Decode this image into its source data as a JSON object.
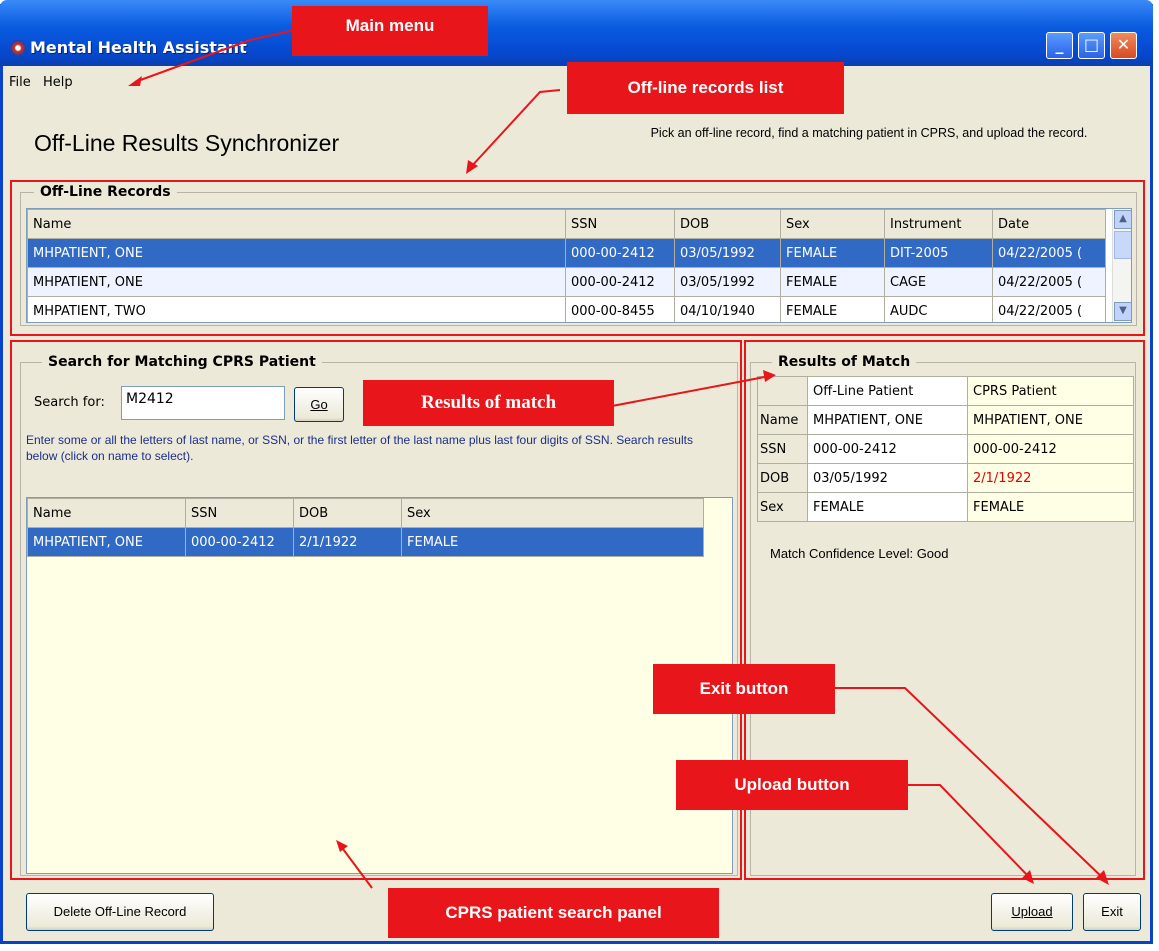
{
  "window": {
    "title": "Mental Health Assistant",
    "minimize": "_",
    "maximize": "□",
    "close": "✕"
  },
  "menu": {
    "file": "File",
    "help": "Help"
  },
  "header": {
    "title": "Off-Line Results Synchronizer",
    "instructions": "Pick an off-line record, find a matching patient in CPRS, and upload the record."
  },
  "offline_records": {
    "group_title": "Off-Line Records",
    "columns": [
      "Name",
      "SSN",
      "DOB",
      "Sex",
      "Instrument",
      "Date"
    ],
    "rows": [
      [
        "MHPATIENT, ONE",
        "000-00-2412",
        "03/05/1992",
        "FEMALE",
        "DIT-2005",
        "04/22/2005 ("
      ],
      [
        "MHPATIENT, ONE",
        "000-00-2412",
        "03/05/1992",
        "FEMALE",
        "CAGE",
        "04/22/2005 ("
      ],
      [
        "MHPATIENT, TWO",
        "000-00-8455",
        "04/10/1940",
        "FEMALE",
        "AUDC",
        "04/22/2005 ("
      ]
    ]
  },
  "search": {
    "group_title": "Search for Matching CPRS Patient",
    "label": "Search for:",
    "value": "M2412",
    "go": "Go",
    "help": "Enter some or all the letters of last name, or SSN, or the first letter of the last name plus last four digits of SSN. Search results below (click on name to select).",
    "columns": [
      "Name",
      "SSN",
      "DOB",
      "Sex"
    ],
    "rows": [
      [
        "MHPATIENT, ONE",
        "000-00-2412",
        "2/1/1922",
        "FEMALE"
      ]
    ]
  },
  "match": {
    "group_title": "Results of Match",
    "col_offline": "Off-Line Patient",
    "col_cprs": "CPRS Patient",
    "rows": [
      {
        "label": "Name",
        "offline": "MHPATIENT, ONE",
        "cprs": "MHPATIENT, ONE"
      },
      {
        "label": "SSN",
        "offline": "000-00-2412",
        "cprs": "000-00-2412"
      },
      {
        "label": "DOB",
        "offline": "03/05/1992",
        "cprs": "2/1/1922"
      },
      {
        "label": "Sex",
        "offline": "FEMALE",
        "cprs": "FEMALE"
      }
    ],
    "confidence": "Match Confidence Level:  Good"
  },
  "buttons": {
    "delete": "Delete Off-Line Record",
    "upload": "Upload",
    "exit": "Exit"
  },
  "annotations": {
    "main_menu": "Main menu",
    "offline_list": "Off-line records  list",
    "results_match": "Results of match",
    "exit_button": "Exit button",
    "upload_button": "Upload button",
    "search_panel": "CPRS  patient search panel"
  },
  "colors": {
    "selection": "#316ac5",
    "annotation": "#e8151a",
    "panel_yellow": "#ffffe6"
  }
}
